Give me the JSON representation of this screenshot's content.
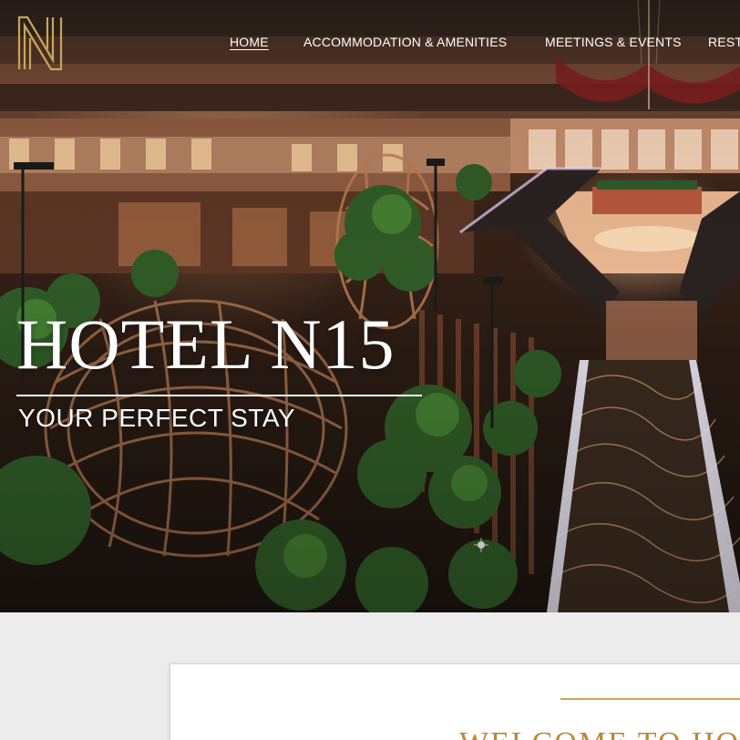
{
  "brand": {
    "logo_letter": "N",
    "logo_icon": "n-monogram-icon",
    "gold": "#c9a55a"
  },
  "nav": {
    "items": [
      {
        "label": "HOME",
        "active": true
      },
      {
        "label": "ACCOMMODATION & AMENITIES",
        "active": false
      },
      {
        "label": "MEETINGS & EVENTS",
        "active": false
      },
      {
        "label": "RESTA",
        "active": false
      }
    ]
  },
  "hero": {
    "title": "HOTEL N15",
    "tagline": "YOUR PERFECT STAY",
    "image_icon": "hotel-atrium-photo"
  },
  "welcome": {
    "heading": "WELCOME TO HOT"
  }
}
